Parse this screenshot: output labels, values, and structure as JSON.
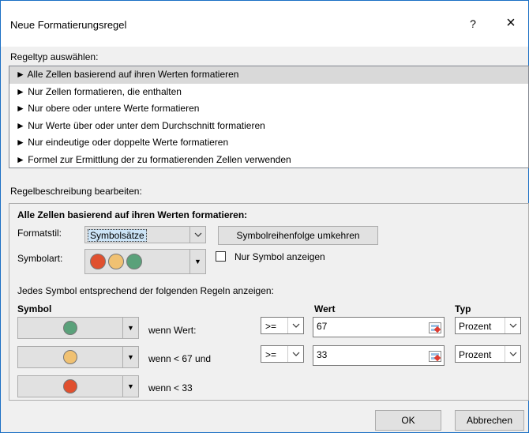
{
  "title": "Neue Formatierungsregel",
  "help_glyph": "?",
  "close_glyph": "×",
  "ruletype_label": "Regeltyp auswählen:",
  "rule_types": [
    {
      "label": "► Alle Zellen basierend auf ihren Werten formatieren",
      "selected": true
    },
    {
      "label": "► Nur Zellen formatieren, die enthalten",
      "selected": false
    },
    {
      "label": "► Nur obere oder untere Werte formatieren",
      "selected": false
    },
    {
      "label": "► Nur Werte über oder unter dem Durchschnitt formatieren",
      "selected": false
    },
    {
      "label": "► Nur eindeutige oder doppelte Werte formatieren",
      "selected": false
    },
    {
      "label": "► Formel zur Ermittlung der zu formatierenden Zellen verwenden",
      "selected": false
    }
  ],
  "description_label": "Regelbeschreibung bearbeiten:",
  "description": {
    "heading": "Alle Zellen basierend auf ihren Werten formatieren:",
    "format_style_label": "Formatstil:",
    "format_style_value": "Symbolsätze",
    "reverse_order_button": "Symbolreihenfolge umkehren",
    "symbol_type_label": "Symbolart:",
    "symbol_type_colors": [
      "#e0502f",
      "#f0c172",
      "#5aa17a"
    ],
    "show_symbol_only_label": "Nur Symbol anzeigen",
    "show_symbol_only_checked": false,
    "rules_caption": "Jedes Symbol entsprechend der folgenden Regeln anzeigen:",
    "col_symbol": "Symbol",
    "col_value": "Wert",
    "col_type": "Typ",
    "rules": [
      {
        "color": "#5aa17a",
        "condition": "wenn Wert:",
        "operator": ">=",
        "value": "67",
        "type": "Prozent"
      },
      {
        "color": "#f0c172",
        "condition": "wenn < 67 und",
        "operator": ">=",
        "value": "33",
        "type": "Prozent"
      },
      {
        "color": "#e0502f",
        "condition": "wenn < 33"
      }
    ]
  },
  "ok_button": "OK",
  "cancel_button": "Abbrechen"
}
